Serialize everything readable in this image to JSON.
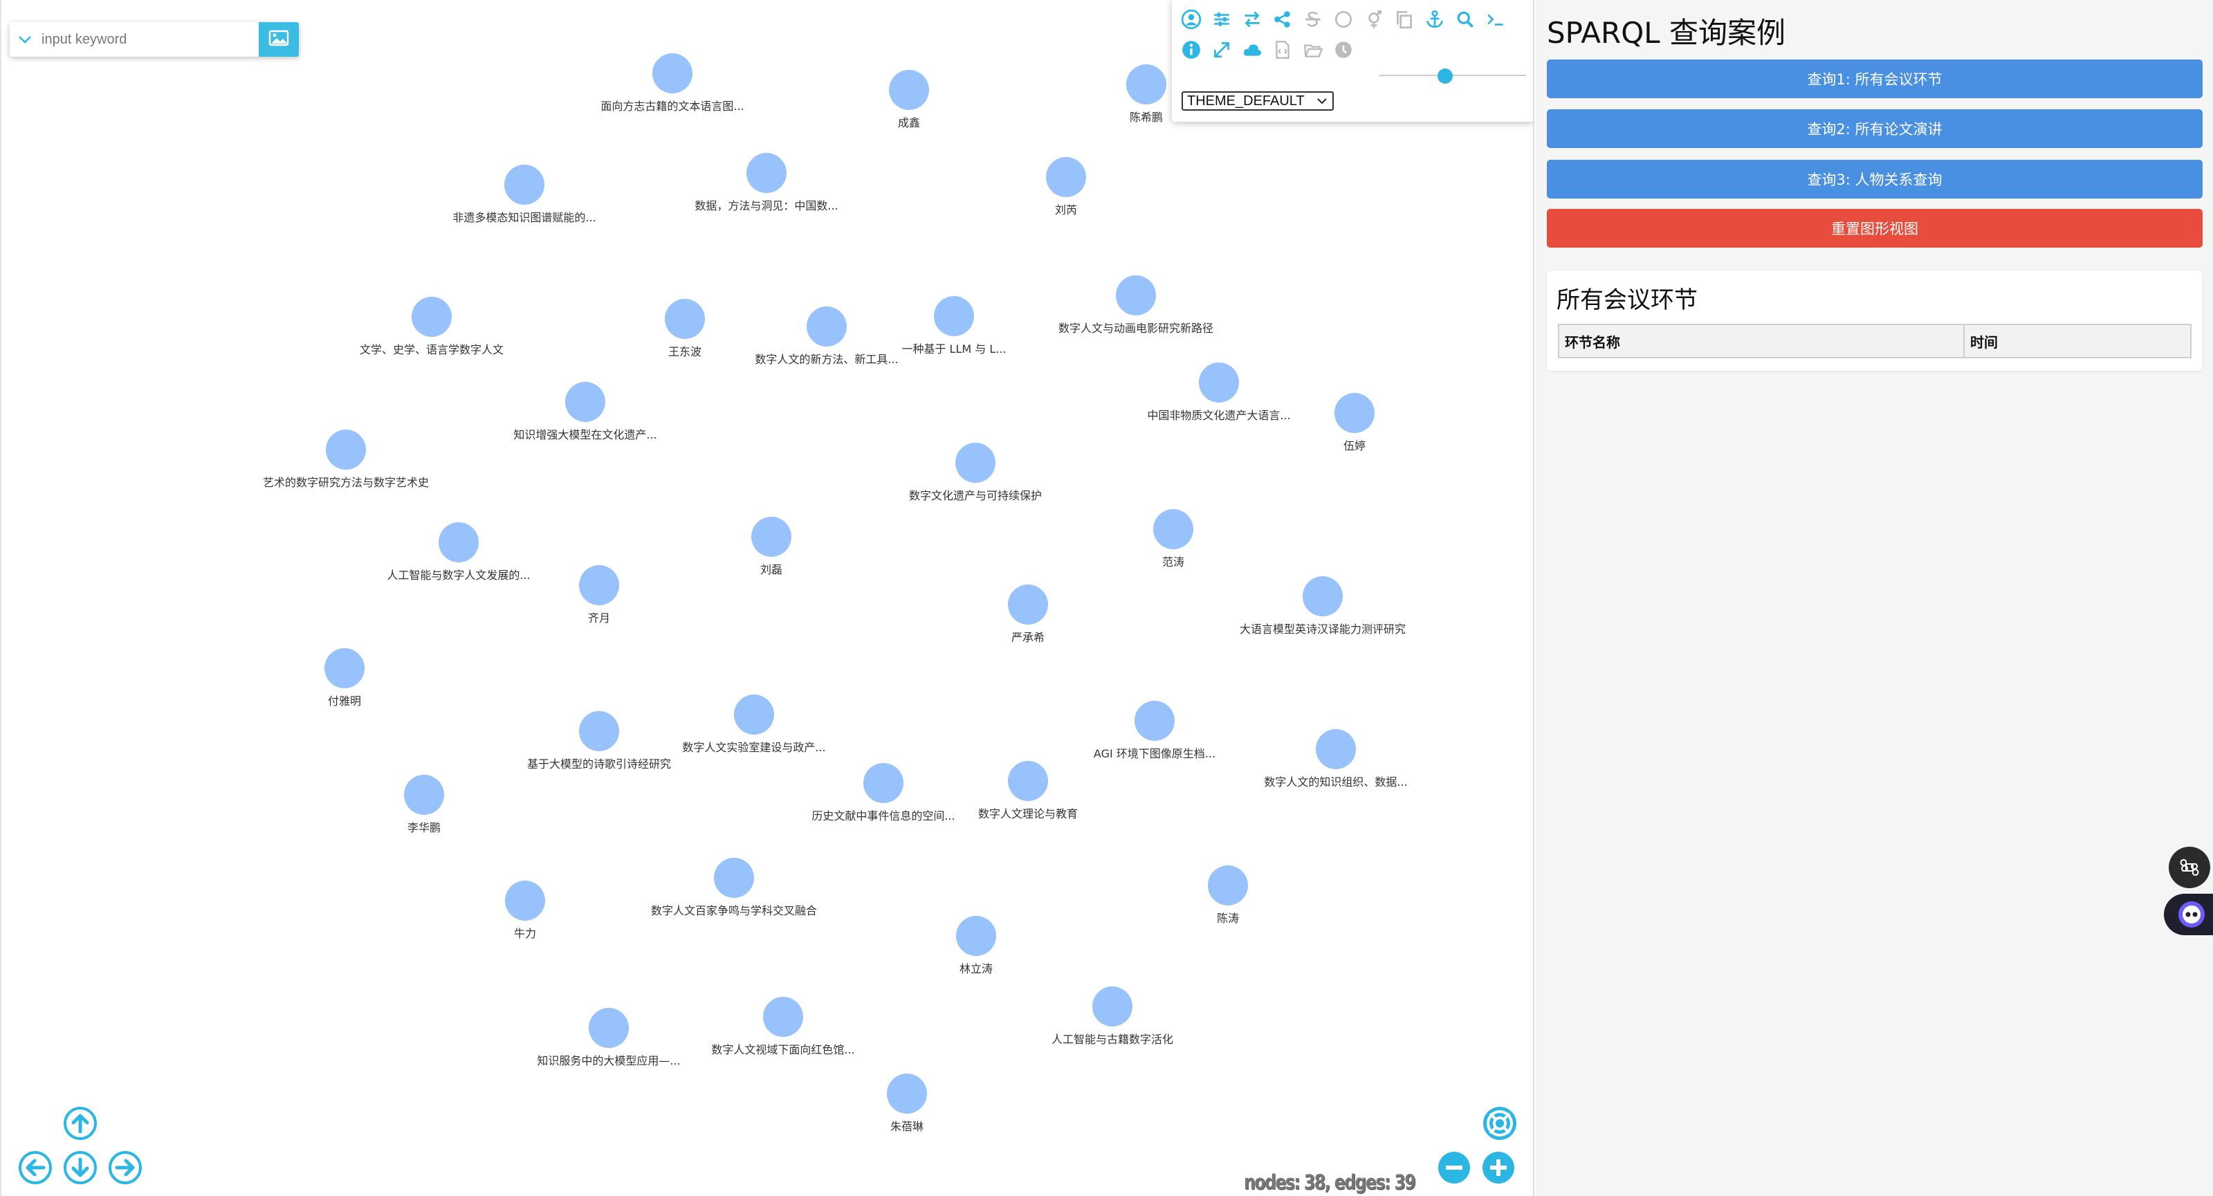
{
  "search": {
    "placeholder": "input keyword"
  },
  "toolbar": {
    "theme_value": "THEME_DEFAULT",
    "zoom_level": 0.5,
    "row1_icons": [
      "user-circle-icon",
      "sliders-icon",
      "swap-icon",
      "share-icon",
      "strikethrough-icon",
      "circle-icon",
      "gender-icon",
      "copy-icon",
      "anchor-icon",
      "search-icon",
      "terminal-icon"
    ],
    "row2_icons": [
      "info-icon",
      "expand-icon",
      "cloud-icon",
      "file-code-icon",
      "folder-open-icon",
      "timer-icon"
    ]
  },
  "graph": {
    "nodes": [
      {
        "label": "面向方志古籍的文本语言图..."
      },
      {
        "label": "成鑫"
      },
      {
        "label": "陈希鹏"
      },
      {
        "label": "非遗多模态知识图谱赋能的..."
      },
      {
        "label": "数据，方法与洞见：中国数..."
      },
      {
        "label": "刘芮"
      },
      {
        "label": "文学、史学、语言学数字人文"
      },
      {
        "label": "王东波"
      },
      {
        "label": "数字人文的新方法、新工具..."
      },
      {
        "label": "一种基于 LLM 与 L..."
      },
      {
        "label": "数字人文与动画电影研究新路径"
      },
      {
        "label": "知识增强大模型在文化遗产..."
      },
      {
        "label": "中国非物质文化遗产大语言..."
      },
      {
        "label": "伍婷"
      },
      {
        "label": "艺术的数字研究方法与数字艺术史"
      },
      {
        "label": "数字文化遗产与可持续保护"
      },
      {
        "label": "人工智能与数字人文发展的..."
      },
      {
        "label": "刘磊"
      },
      {
        "label": "范涛"
      },
      {
        "label": "齐月"
      },
      {
        "label": "严承希"
      },
      {
        "label": "大语言模型英诗汉译能力测评研究"
      },
      {
        "label": "付雅明"
      },
      {
        "label": "数字人文实验室建设与政产..."
      },
      {
        "label": "基于大模型的诗歌引诗经研究"
      },
      {
        "label": "AGI 环境下图像原生档..."
      },
      {
        "label": "数字人文的知识组织、数据..."
      },
      {
        "label": "历史文献中事件信息的空间..."
      },
      {
        "label": "数字人文理论与教育"
      },
      {
        "label": "李华鹏"
      },
      {
        "label": "数字人文百家争鸣与学科交叉融合"
      },
      {
        "label": "陈涛"
      },
      {
        "label": "牛力"
      },
      {
        "label": "林立涛"
      },
      {
        "label": "人工智能与古籍数字活化"
      },
      {
        "label": "知识服务中的大模型应用—..."
      },
      {
        "label": "数字人文视域下面向红色馆..."
      },
      {
        "label": "朱蓓琳"
      }
    ],
    "counter": "nodes: 38, edges: 39"
  },
  "panel": {
    "title": "SPARQL 查询案例",
    "buttons": {
      "q1": "查询1: 所有会议环节",
      "q2": "查询2: 所有论文演讲",
      "q3": "查询3: 人物关系查询",
      "reset": "重置图形视图"
    },
    "result": {
      "title": "所有会议环节",
      "columns": [
        "环节名称",
        "时间"
      ]
    }
  },
  "colors": {
    "node": "#97c2fc",
    "accent": "#2bb6e4",
    "query_button": "#4a90e2",
    "reset_button": "#e74c3c"
  }
}
